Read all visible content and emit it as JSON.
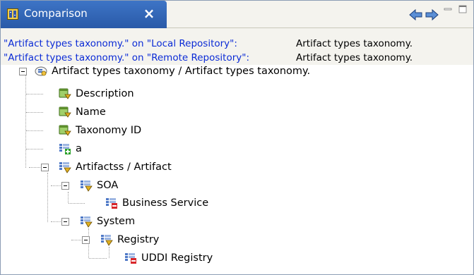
{
  "tab": {
    "title": "Comparison",
    "close_glyph": "×",
    "icon": "comparison-view-icon"
  },
  "toolbar": {
    "prev_icon": "previous-difference-icon",
    "next_icon": "next-difference-icon",
    "minimize_icon": "minimize-icon",
    "maximize_icon": "maximize-icon"
  },
  "header": {
    "lines": [
      {
        "key": "\"Artifact types taxonomy.\" on \"Local Repository\":",
        "value": "Artifact types taxonomy."
      },
      {
        "key": "\"Artifact types taxonomy.\" on \"Remote Repository\":",
        "value": "Artifact types taxonomy."
      }
    ]
  },
  "tree": {
    "nodes": [
      {
        "label": "Artifact types taxonomy / Artifact types taxonomy.",
        "icon": "taxonomy-icon",
        "depth": 0,
        "expanded": true
      },
      {
        "label": "Description",
        "icon": "changed-property-icon",
        "depth": 1
      },
      {
        "label": "Name",
        "icon": "changed-property-icon",
        "depth": 1
      },
      {
        "label": "Taxonomy ID",
        "icon": "changed-property-icon",
        "depth": 1
      },
      {
        "label": "a",
        "icon": "added-item-icon",
        "depth": 1
      },
      {
        "label": "Artifactss / Artifact",
        "icon": "modified-item-icon",
        "depth": 1,
        "expanded": true
      },
      {
        "label": "SOA",
        "icon": "modified-item-icon",
        "depth": 2,
        "expanded": true
      },
      {
        "label": "Business Service",
        "icon": "removed-item-icon",
        "depth": 3
      },
      {
        "label": "System",
        "icon": "modified-item-icon",
        "depth": 2,
        "expanded": true
      },
      {
        "label": "Registry",
        "icon": "modified-item-icon",
        "depth": 3,
        "expanded": true
      },
      {
        "label": "UDDI Registry",
        "icon": "removed-item-icon",
        "depth": 4
      }
    ]
  },
  "colors": {
    "tab_active": "#2f62b2",
    "header_key": "#0b2bd6",
    "added": "#2aa02a",
    "removed": "#d8262a",
    "changed": "#4f9a2c"
  }
}
